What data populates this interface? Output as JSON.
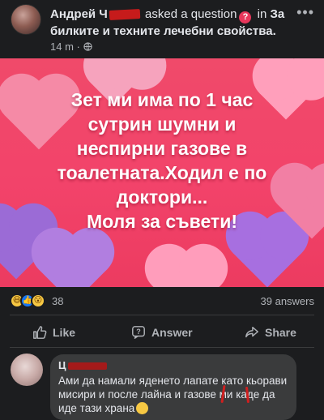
{
  "post": {
    "author_name_visible": "Андрей Ч",
    "action_text": "asked a question",
    "in_word": "in",
    "topic": "За билките и техните лечебни свойства.",
    "time": "14 m",
    "more_icon": "more-options-icon"
  },
  "banner": {
    "lines": [
      "Зет ми има по 1 час",
      "сутрин шумни и",
      "неспирни газове в",
      "тоалетната.Ходил е по",
      "доктори...",
      "Моля за съвети!"
    ],
    "background_color": "#f04a6a",
    "text_color": "#ffffff"
  },
  "stats": {
    "reactions_count": "38",
    "answers_count": "39 answers",
    "reaction_icons": [
      "haha",
      "like",
      "wow"
    ]
  },
  "actions": {
    "like_label": "Like",
    "answer_label": "Answer",
    "share_label": "Share"
  },
  "comment": {
    "author_visible": "Ц",
    "text": "Ами да намали яденето лапате като кьорави мисири и после лайна и газове ми каде да иде тази храна"
  },
  "colors": {
    "background": "#1c1d1f",
    "bubble": "#3a3b3c",
    "muted_text": "#b0b3b8",
    "primary_text": "#e4e6eb",
    "question_badge": "#e8375b"
  }
}
